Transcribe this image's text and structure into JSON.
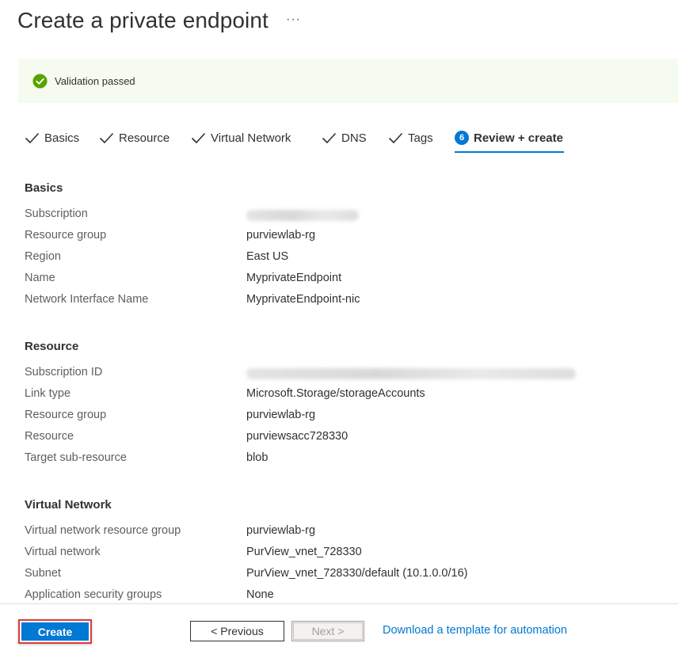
{
  "header": {
    "title": "Create a private endpoint",
    "more_label": "···"
  },
  "banner": {
    "text": "Validation passed",
    "icon": "check-circle-icon",
    "color": "#57a300"
  },
  "tabs": [
    {
      "label": "Basics",
      "state": "completed"
    },
    {
      "label": "Resource",
      "state": "completed"
    },
    {
      "label": "Virtual Network",
      "state": "completed"
    },
    {
      "label": "DNS",
      "state": "completed"
    },
    {
      "label": "Tags",
      "state": "completed"
    },
    {
      "label": "Review + create",
      "step": "6",
      "state": "active"
    }
  ],
  "sections": {
    "basics": {
      "title": "Basics",
      "rows": [
        {
          "key": "Subscription",
          "value": "",
          "redacted": true
        },
        {
          "key": "Resource group",
          "value": "purviewlab-rg"
        },
        {
          "key": "Region",
          "value": "East US"
        },
        {
          "key": "Name",
          "value": "MyprivateEndpoint"
        },
        {
          "key": "Network Interface Name",
          "value": "MyprivateEndpoint-nic"
        }
      ]
    },
    "resource": {
      "title": "Resource",
      "rows": [
        {
          "key": "Subscription ID",
          "value": "",
          "redacted": true
        },
        {
          "key": "Link type",
          "value": "Microsoft.Storage/storageAccounts"
        },
        {
          "key": "Resource group",
          "value": "purviewlab-rg"
        },
        {
          "key": "Resource",
          "value": "purviewsacc728330"
        },
        {
          "key": "Target sub-resource",
          "value": "blob"
        }
      ]
    },
    "vnet": {
      "title": "Virtual Network",
      "rows": [
        {
          "key": "Virtual network resource group",
          "value": "purviewlab-rg"
        },
        {
          "key": "Virtual network",
          "value": "PurView_vnet_728330"
        },
        {
          "key": "Subnet",
          "value": "PurView_vnet_728330/default (10.1.0.0/16)"
        },
        {
          "key": "Application security groups",
          "value": "None"
        }
      ]
    }
  },
  "footer": {
    "create_label": "Create",
    "previous_label": "< Previous",
    "next_label": "Next >",
    "download_link": "Download a template for automation"
  },
  "colors": {
    "accent": "#0078d4",
    "banner_bg": "#f5fbee",
    "highlight_border": "#e03a3a"
  }
}
